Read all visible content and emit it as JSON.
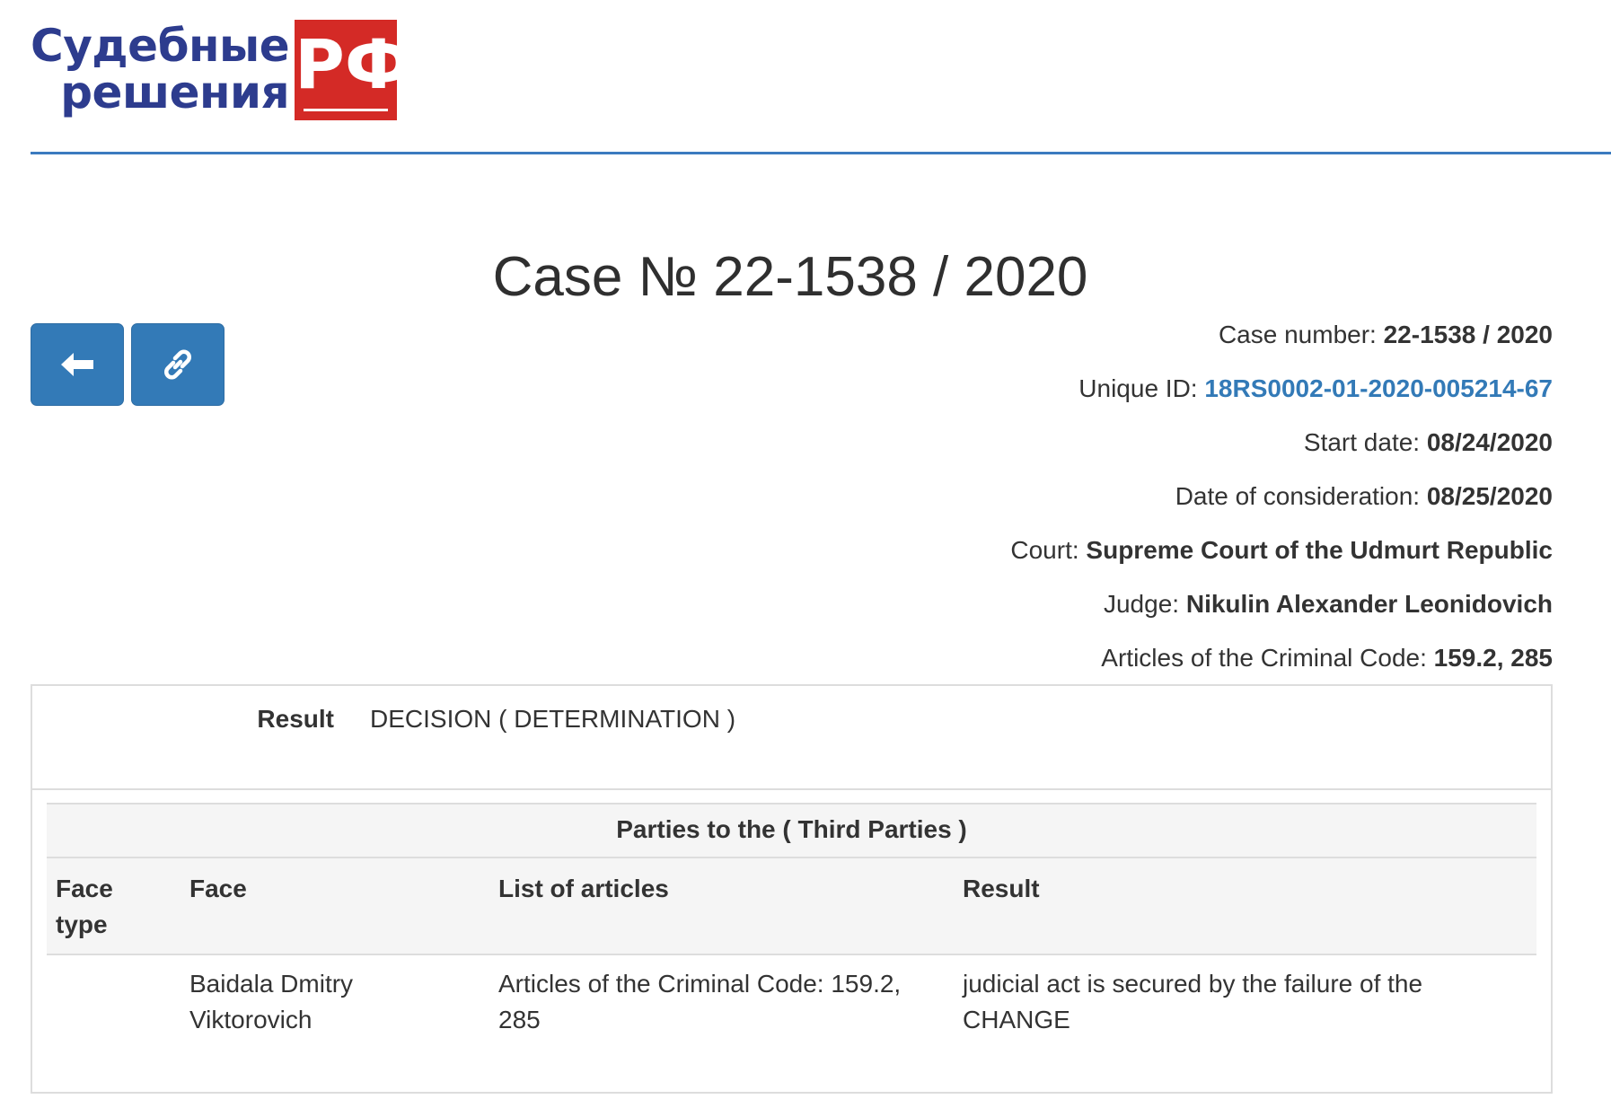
{
  "logo": {
    "line1": "Судебные",
    "line2": "решения",
    "badge": "РФ",
    "text_color": "#2d3c8e",
    "badge_color": "#d42a26"
  },
  "title": "Case № 22-1538 / 2020",
  "buttons": {
    "back_icon": "arrow-left-icon",
    "link_icon": "chain-link-icon",
    "color": "#337ab7"
  },
  "meta": {
    "case_number": {
      "label": "Case number:",
      "value": "22-1538 / 2020"
    },
    "unique_id": {
      "label": "Unique ID:",
      "value": "18RS0002-01-2020-005214-67"
    },
    "start_date": {
      "label": "Start date:",
      "value": "08/24/2020"
    },
    "consideration_date": {
      "label": "Date of consideration:",
      "value": "08/25/2020"
    },
    "court": {
      "label": "Court:",
      "value": "Supreme Court of the Udmurt Republic"
    },
    "judge": {
      "label": "Judge:",
      "value": "Nikulin Alexander Leonidovich"
    },
    "articles": {
      "label": "Articles of the Criminal Code:",
      "value": "159.2, 285"
    }
  },
  "result": {
    "label": "Result",
    "value": "DECISION ( DETERMINATION )"
  },
  "parties": {
    "caption": "Parties to the ( Third Parties )",
    "columns": [
      "Face type",
      "Face",
      "List of articles",
      "Result"
    ],
    "rows": [
      {
        "face_type": "",
        "face": "Baidala Dmitry Viktorovich",
        "articles": "Articles of the Criminal Code: 159.2, 285",
        "result": "judicial act is secured by the failure of the CHANGE"
      }
    ]
  }
}
